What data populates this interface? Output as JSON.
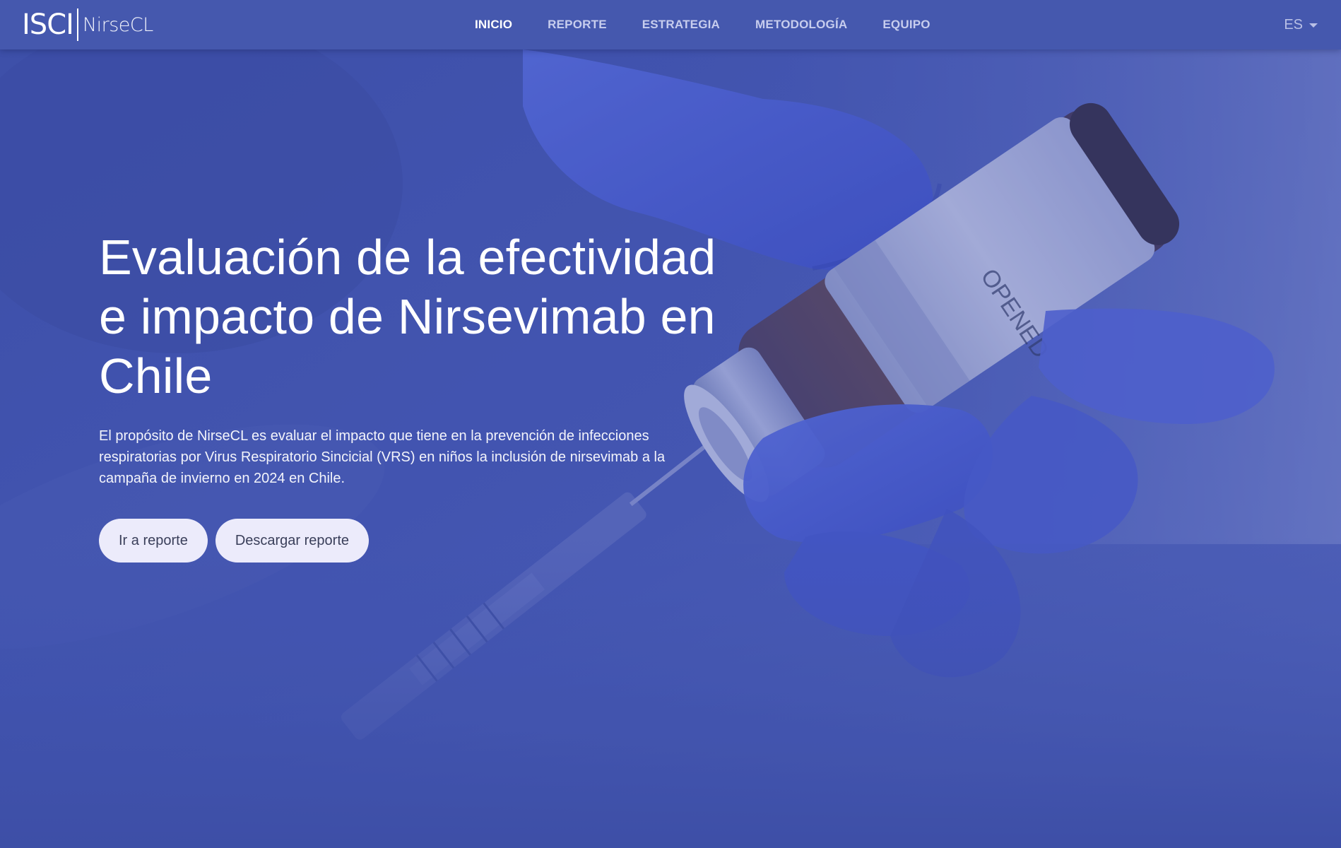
{
  "navbar": {
    "brand": {
      "logo_text": "ISCI",
      "site_name": "NirseCL"
    },
    "links": [
      {
        "label": "INICIO",
        "active": true
      },
      {
        "label": "REPORTE",
        "active": false
      },
      {
        "label": "ESTRATEGIA",
        "active": false
      },
      {
        "label": "METODOLOGÍA",
        "active": false
      },
      {
        "label": "EQUIPO",
        "active": false
      }
    ],
    "language": {
      "selected": "ES"
    }
  },
  "hero": {
    "title": "Evaluación de la efectividad e impacto de Nirsevimab en Chile",
    "description": "El propósito de NirseCL es evaluar el impacto que tiene en la prevención de infecciones respiratorias por Virus Respiratorio Sincicial (VRS) en niños la inclusión de nirsevimab a la campaña de invierno en 2024 en Chile.",
    "buttons": {
      "primary_label": "Ir a reporte",
      "secondary_label": "Descargar reporte"
    },
    "background_image": "gloved-hands-holding-vial-and-syringe"
  },
  "colors": {
    "nav_background": "#4558ae",
    "hero_overlay": "#4256af",
    "button_background": "#ecebfb",
    "nav_link_active": "#ffffff",
    "nav_link_inactive": "#c7cdee"
  }
}
